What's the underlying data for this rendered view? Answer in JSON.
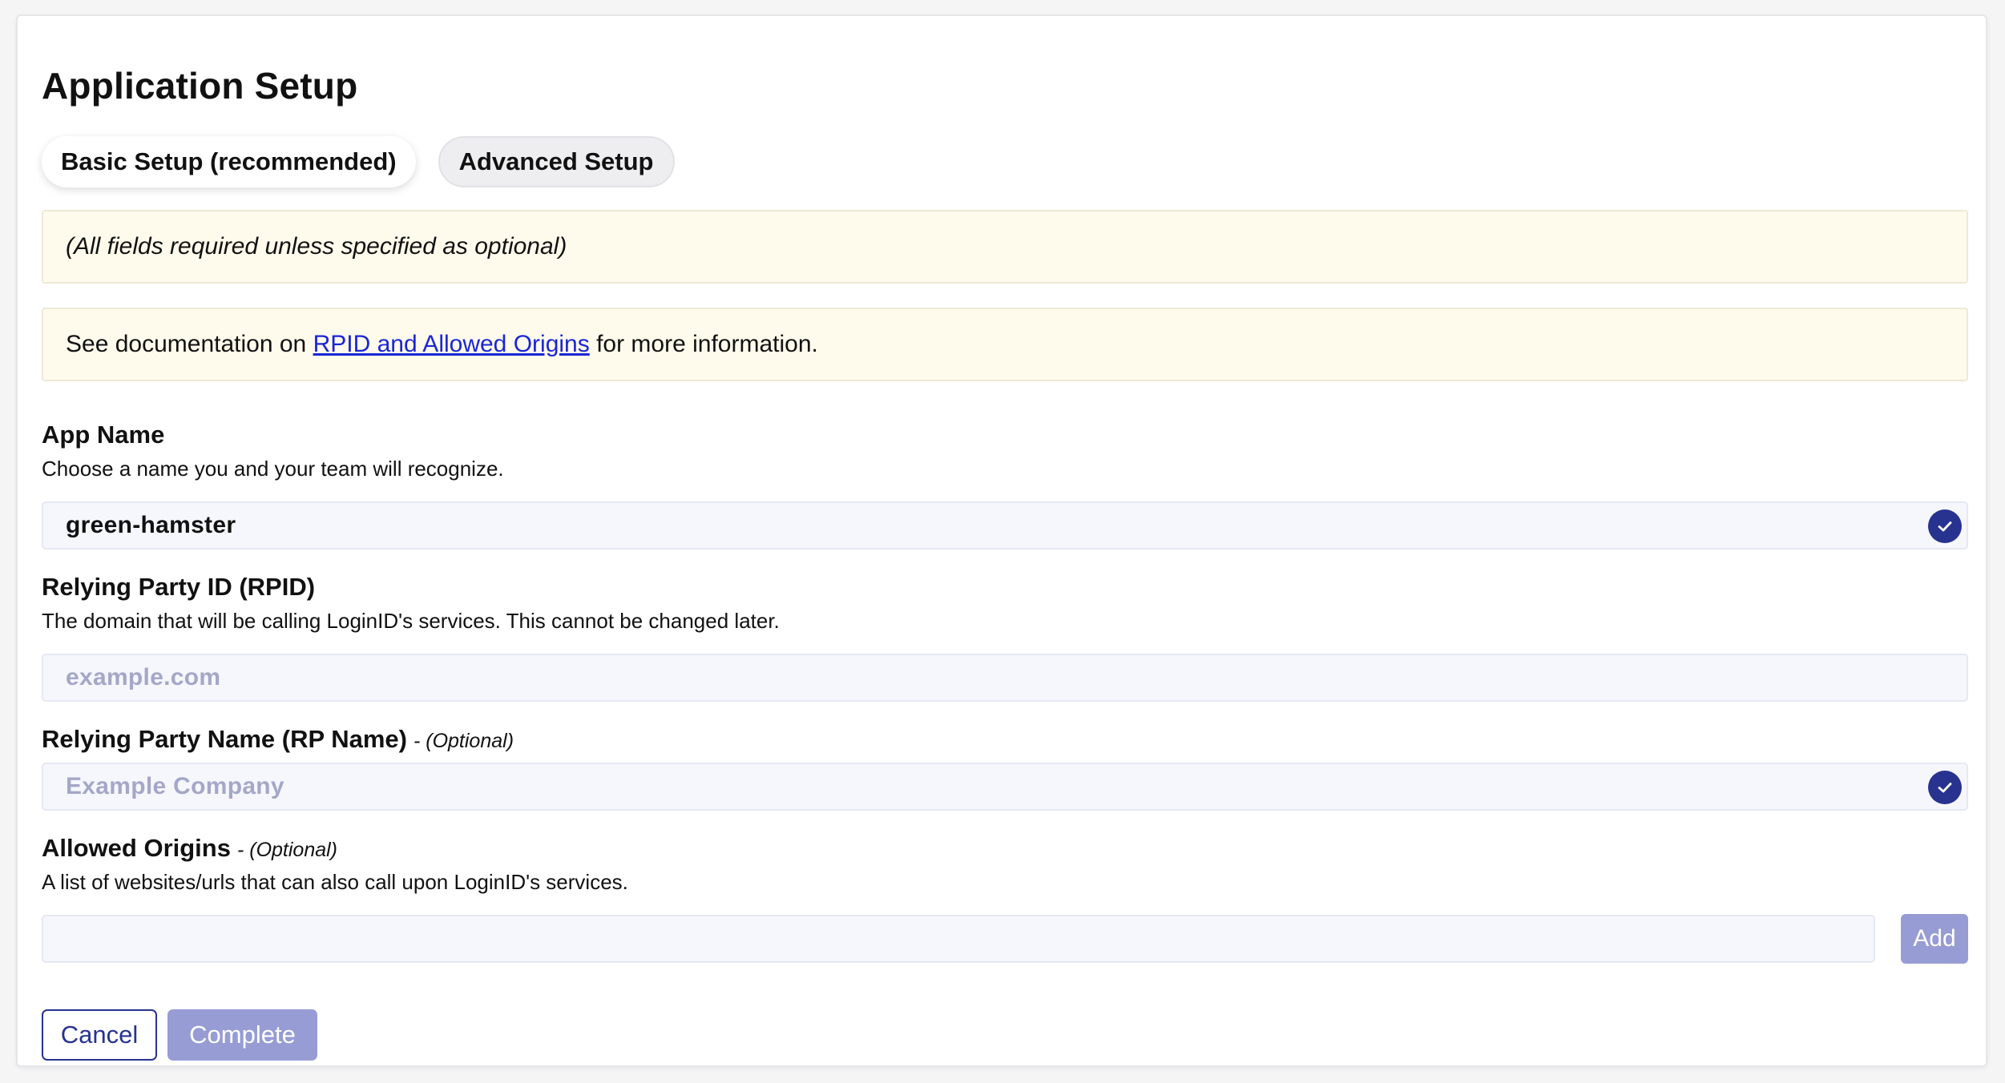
{
  "page": {
    "title": "Application Setup"
  },
  "tabs": [
    {
      "label": "Basic Setup (recommended)",
      "active": true
    },
    {
      "label": "Advanced Setup",
      "active": false
    }
  ],
  "notices": {
    "required_note": "(All fields required unless specified as optional)",
    "docs_prefix": "See documentation on ",
    "docs_link": "RPID and Allowed Origins",
    "docs_suffix": " for more information."
  },
  "fields": {
    "app_name": {
      "label": "App Name",
      "description": "Choose a name you and your team will recognize.",
      "value": "green-hamster",
      "valid_icon": "check-circle-icon"
    },
    "rpid": {
      "label": "Relying Party ID (RPID)",
      "description": "The domain that will be calling LoginID's services. This cannot be changed later.",
      "placeholder": "example.com"
    },
    "rp_name": {
      "label": "Relying Party Name (RP Name)",
      "optional": "- (Optional)",
      "placeholder": "Example Company",
      "valid_icon": "check-circle-icon"
    },
    "allowed_origins": {
      "label": "Allowed Origins",
      "optional": "- (Optional)",
      "description": "A list of websites/urls that can also call upon LoginID's services.",
      "value": "",
      "add_label": "Add"
    }
  },
  "actions": {
    "cancel_label": "Cancel",
    "complete_label": "Complete"
  },
  "colors": {
    "primary": "#27338f",
    "primary_disabled": "#979cd4",
    "notice_bg": "#fefbec",
    "input_bg": "#f6f7fd",
    "link": "#1a26d6"
  }
}
